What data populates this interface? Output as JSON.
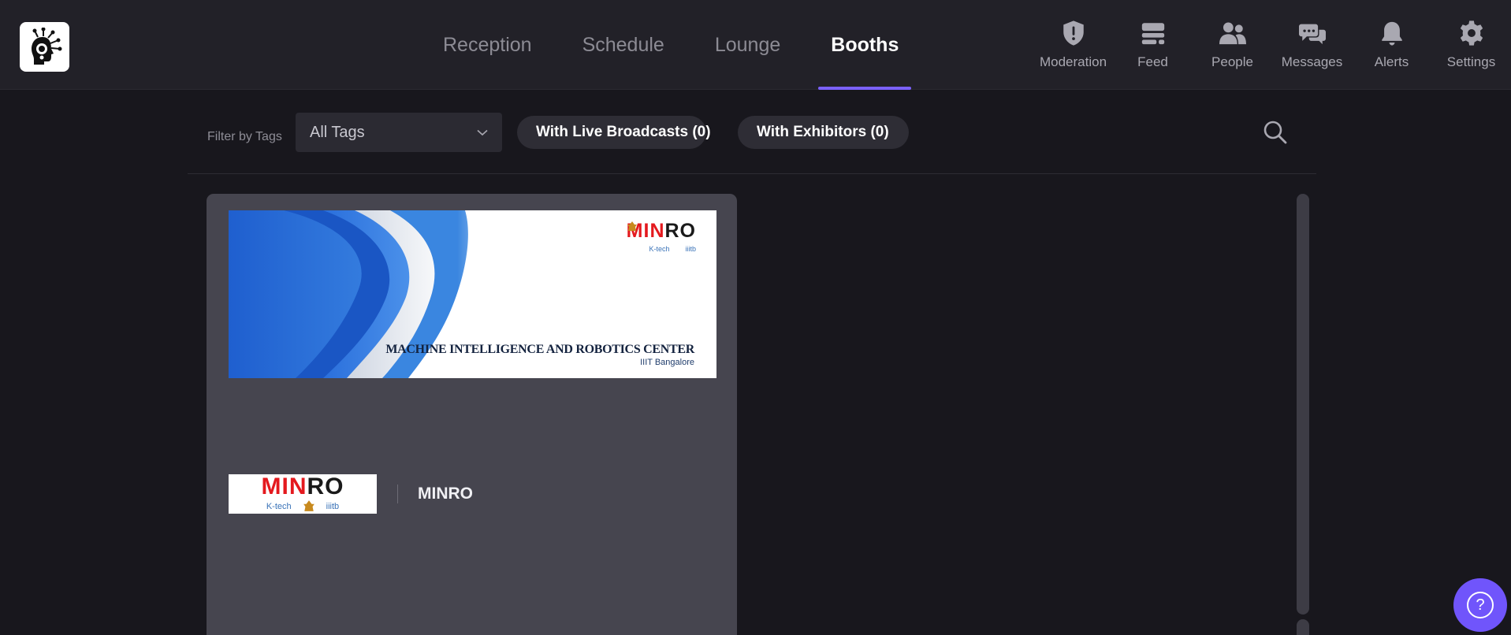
{
  "header": {
    "logo_alt": "app-logo",
    "tabs": [
      {
        "label": "Reception",
        "active": false
      },
      {
        "label": "Schedule",
        "active": false
      },
      {
        "label": "Lounge",
        "active": false
      },
      {
        "label": "Booths",
        "active": true
      }
    ],
    "icon_nav": [
      {
        "label": "Moderation",
        "icon": "shield-exclamation-icon"
      },
      {
        "label": "Feed",
        "icon": "feed-icon"
      },
      {
        "label": "People",
        "icon": "people-icon"
      },
      {
        "label": "Messages",
        "icon": "chat-bubbles-icon"
      },
      {
        "label": "Alerts",
        "icon": "bell-icon"
      },
      {
        "label": "Settings",
        "icon": "gear-icon"
      }
    ]
  },
  "filters": {
    "label": "Filter by Tags",
    "tag_select_value": "All Tags",
    "live_broadcasts": "With Live Broadcasts (0)",
    "exhibitors": "With Exhibitors (0)"
  },
  "booths": [
    {
      "name": "MINRO",
      "banner": {
        "logo_red": "MIN",
        "logo_black": "RO",
        "sub_logos": [
          "K-tech",
          "emblem",
          "iiitb"
        ],
        "title": "MACHINE INTELLIGENCE AND ROBOTICS CENTER",
        "subtitle": "IIIT Bangalore"
      },
      "logo": {
        "logo_red": "MIN",
        "logo_black": "RO",
        "sub_logos": [
          "K-tech",
          "emblem",
          "iiitb"
        ]
      }
    }
  ],
  "help": {
    "label": "?"
  },
  "colors": {
    "background": "#18171d",
    "topbar": "#222128",
    "accent": "#7b61ff",
    "card": "#46454f"
  }
}
